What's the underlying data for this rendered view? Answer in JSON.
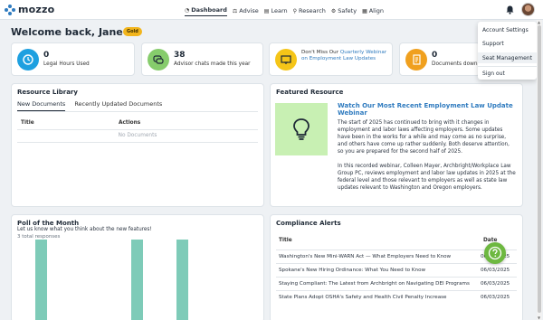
{
  "app": {
    "logo_text": "mozzo"
  },
  "nav": {
    "items": [
      {
        "label": "Dashboard",
        "icon": "dashboard-icon"
      },
      {
        "label": "Advise",
        "icon": "scale-icon"
      },
      {
        "label": "Learn",
        "icon": "book-icon"
      },
      {
        "label": "Research",
        "icon": "research-icon"
      },
      {
        "label": "Safety",
        "icon": "safety-icon"
      },
      {
        "label": "Align",
        "icon": "align-icon"
      }
    ],
    "active": "Dashboard"
  },
  "welcome": {
    "title": "Welcome back, Jane",
    "badge": "Gold"
  },
  "stats": [
    {
      "number": "0",
      "label": "Legal Hours Used",
      "color": "#1ea0e0"
    },
    {
      "number": "38",
      "label": "Advisor chats made this year",
      "color": "#86cc6c"
    },
    {
      "promo_prefix": "Don't Miss Our",
      "promo_link": "Quarterly Webinar on Employment Law Updates",
      "color": "#f5c518"
    },
    {
      "number": "0",
      "label": "Documents downlo",
      "color": "#f0a01e"
    }
  ],
  "resource_library": {
    "title": "Resource Library",
    "tabs": [
      "New Documents",
      "Recently Updated Documents"
    ],
    "columns": [
      "Title",
      "Actions"
    ],
    "empty_text": "No Documents"
  },
  "featured": {
    "title": "Featured Resource",
    "heading": "Watch Our Most Recent Employment Law Update Webinar",
    "paragraphs": [
      "The start of 2025 has continued to bring with it changes in employment and labor laws affecting employers. Some updates have been in the works for a while and may come as no surprise, and others have come up rather suddenly. Both deserve attention, so you are prepared for the second half of 2025.",
      "In this recorded webinar, Colleen Mayer, Archbright/Workplace Law Group PC, reviews employment and labor law updates in 2025 at the federal level and those relevant to employers as well as state law updates relevant to Washington and Oregon employers."
    ]
  },
  "poll": {
    "title": "Poll of the Month",
    "subtitle": "Let us know what you think about the new features!",
    "count": "3 total responses",
    "chart_data": {
      "type": "bar",
      "categories": [
        "",
        "",
        "",
        ""
      ],
      "values": [
        3,
        0,
        3,
        3
      ],
      "bar_color": "#7ecbb8"
    }
  },
  "compliance": {
    "title": "Compliance Alerts",
    "columns": [
      "Title",
      "Date"
    ],
    "rows": [
      {
        "title": "Washington's New Mini-WARN Act — What Employers Need to Know",
        "date": "06/03/2025"
      },
      {
        "title": "Spokane's New Hiring Ordinance: What You Need to Know",
        "date": "06/03/2025"
      },
      {
        "title": "Staying Compliant: The Latest from Archbright on Navigating DEI Programs",
        "date": "06/03/2025"
      },
      {
        "title": "State Plans Adopt OSHA's Safety and Health Civil Penalty Increase",
        "date": "06/03/2025"
      }
    ]
  },
  "user_menu": {
    "items": [
      "Account Settings",
      "Support",
      "Seat Management",
      "Sign out"
    ],
    "selected": "Seat Management"
  }
}
